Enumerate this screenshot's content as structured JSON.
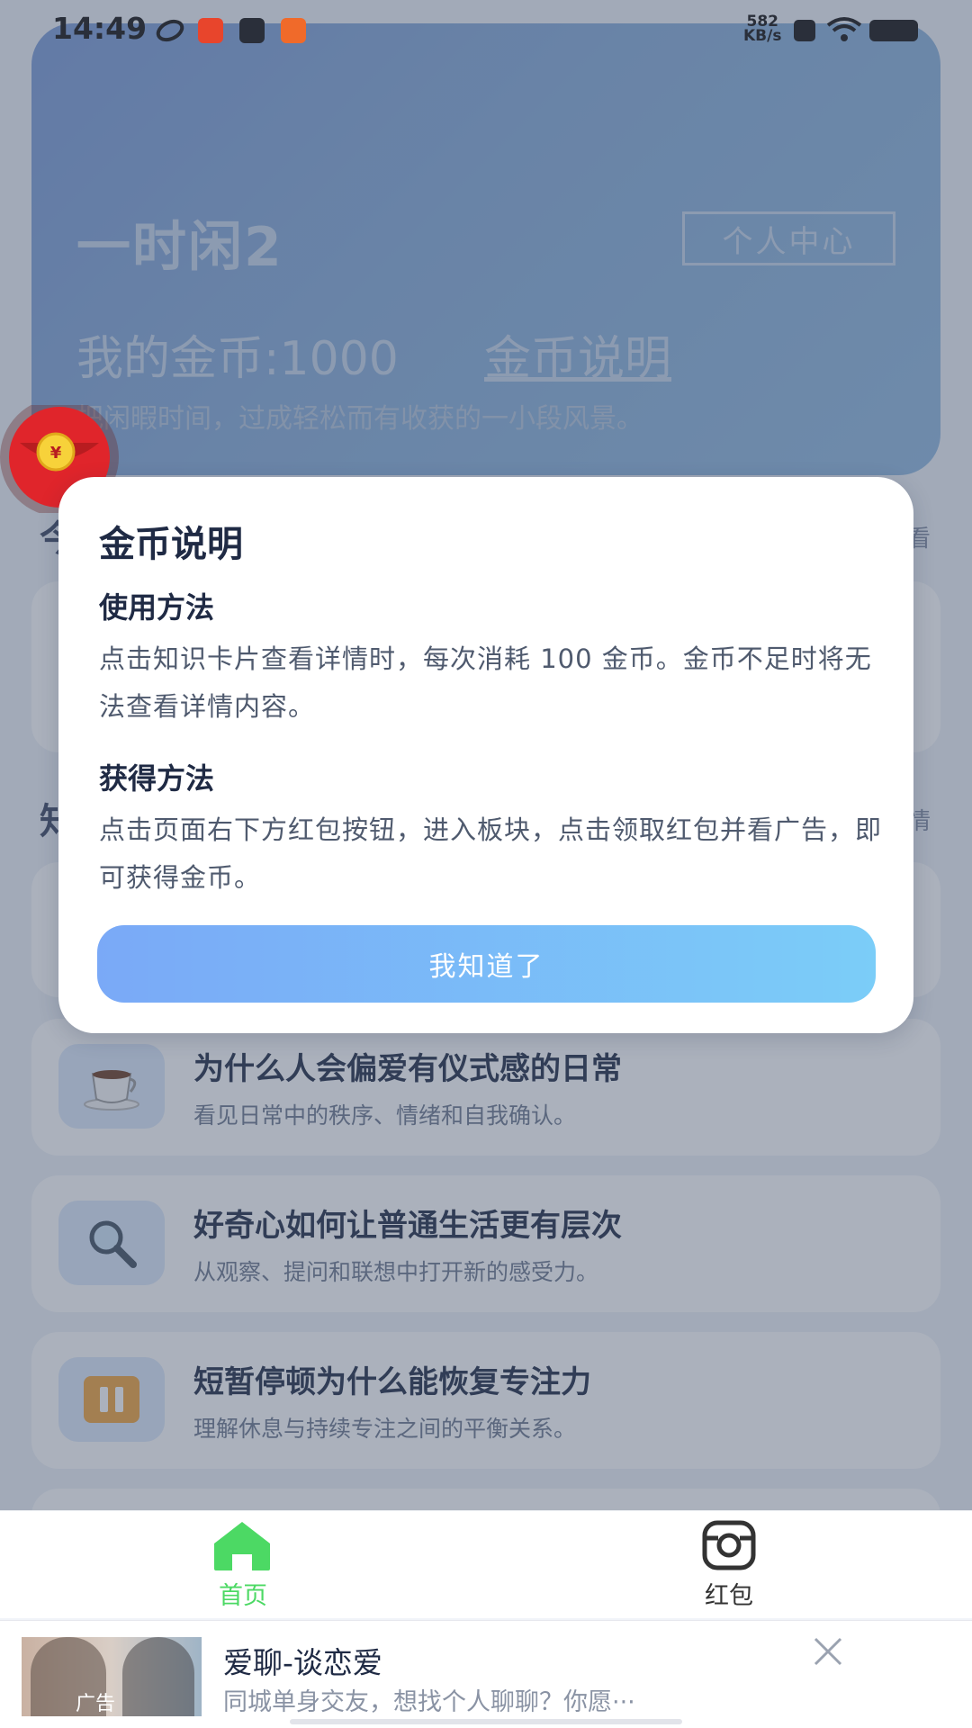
{
  "status_bar": {
    "time": "14:49",
    "net_speed_value": "582",
    "net_speed_unit": "KB/s"
  },
  "header": {
    "app_title": "一时闲2",
    "profile_button": "个人中心",
    "coins_label": "我的金币:1000",
    "coin_info_link": "金币说明",
    "subtitle": "把闲暇时间，过成轻松而有收获的一小段风景。"
  },
  "sections": {
    "first_more": "看",
    "knowledge_title_char": "知",
    "knowledge_more": "情"
  },
  "modal": {
    "title": "金币说明",
    "use_heading": "使用方法",
    "use_text": "点击知识卡片查看详情时，每次消耗 100 金币。金币不足时将无法查看详情内容。",
    "earn_heading": "获得方法",
    "earn_text": "点击页面右下方红包按钮，进入板块，点击领取红包并看广告，即可获得金币。",
    "ok_button": "我知道了"
  },
  "knowledge_cards": [
    {
      "icon": "coffee-cup-icon",
      "title": "为什么人会偏爱有仪式感的日常",
      "desc": "看见日常中的秩序、情绪和自我确认。"
    },
    {
      "icon": "magnifier-icon",
      "title": "好奇心如何让普通生活更有层次",
      "desc": "从观察、提问和联想中打开新的感受力。"
    },
    {
      "icon": "pause-icon",
      "title": "短暂停顿为什么能恢复专注力",
      "desc": "理解休息与持续专注之间的平衡关系。"
    }
  ],
  "tab_bar": {
    "home_label": "首页",
    "redpacket_label": "红包"
  },
  "ad": {
    "tag": "广告",
    "title": "爱聊-谈恋爱",
    "desc": "同城单身交友，想找个人聊聊？你愿···"
  },
  "colors": {
    "accent_green": "#4cd964",
    "button_gradient_start": "#7aa9f7",
    "button_gradient_end": "#7bcdf8",
    "red_packet": "#e0252b"
  }
}
